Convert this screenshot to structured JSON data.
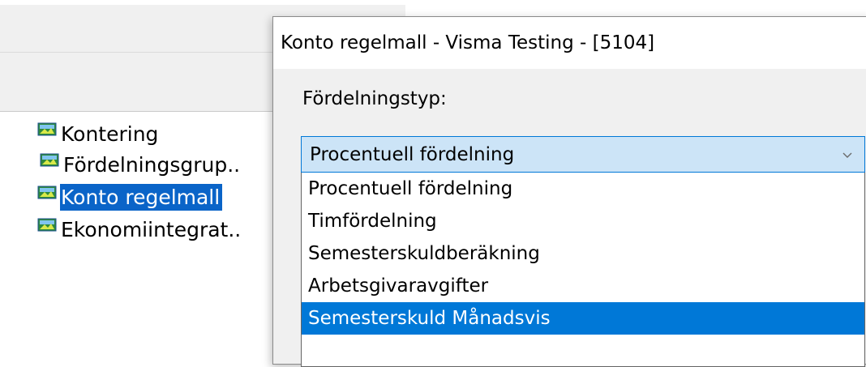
{
  "tree": {
    "items": [
      {
        "label": "Kontering",
        "selected": false
      },
      {
        "label": "Fördelningsgrup..",
        "selected": false
      },
      {
        "label": "Konto regelmall",
        "selected": true
      },
      {
        "label": "Ekonomiintegrat..",
        "selected": false
      }
    ],
    "icon": "tree-node-icon"
  },
  "dialog": {
    "title": "Konto regelmall - Visma Testing - [5104]",
    "field_label": "Fördelningstyp:",
    "combo": {
      "selected_value": "Procentuell fördelning",
      "arrow_icon": "chevron-down-icon"
    },
    "options": [
      "Procentuell fördelning",
      "Timfördelning",
      "Semesterskuldberäkning",
      "Arbetsgivaravgifter",
      "Semesterskuld Månadsvis"
    ],
    "highlighted_option": "Semesterskuld Månadsvis"
  },
  "colors": {
    "selection_tree": "#0a64c8",
    "selection_list": "#0078d7",
    "combo_background": "#cce4f7",
    "window_background": "#f0f0f0"
  }
}
